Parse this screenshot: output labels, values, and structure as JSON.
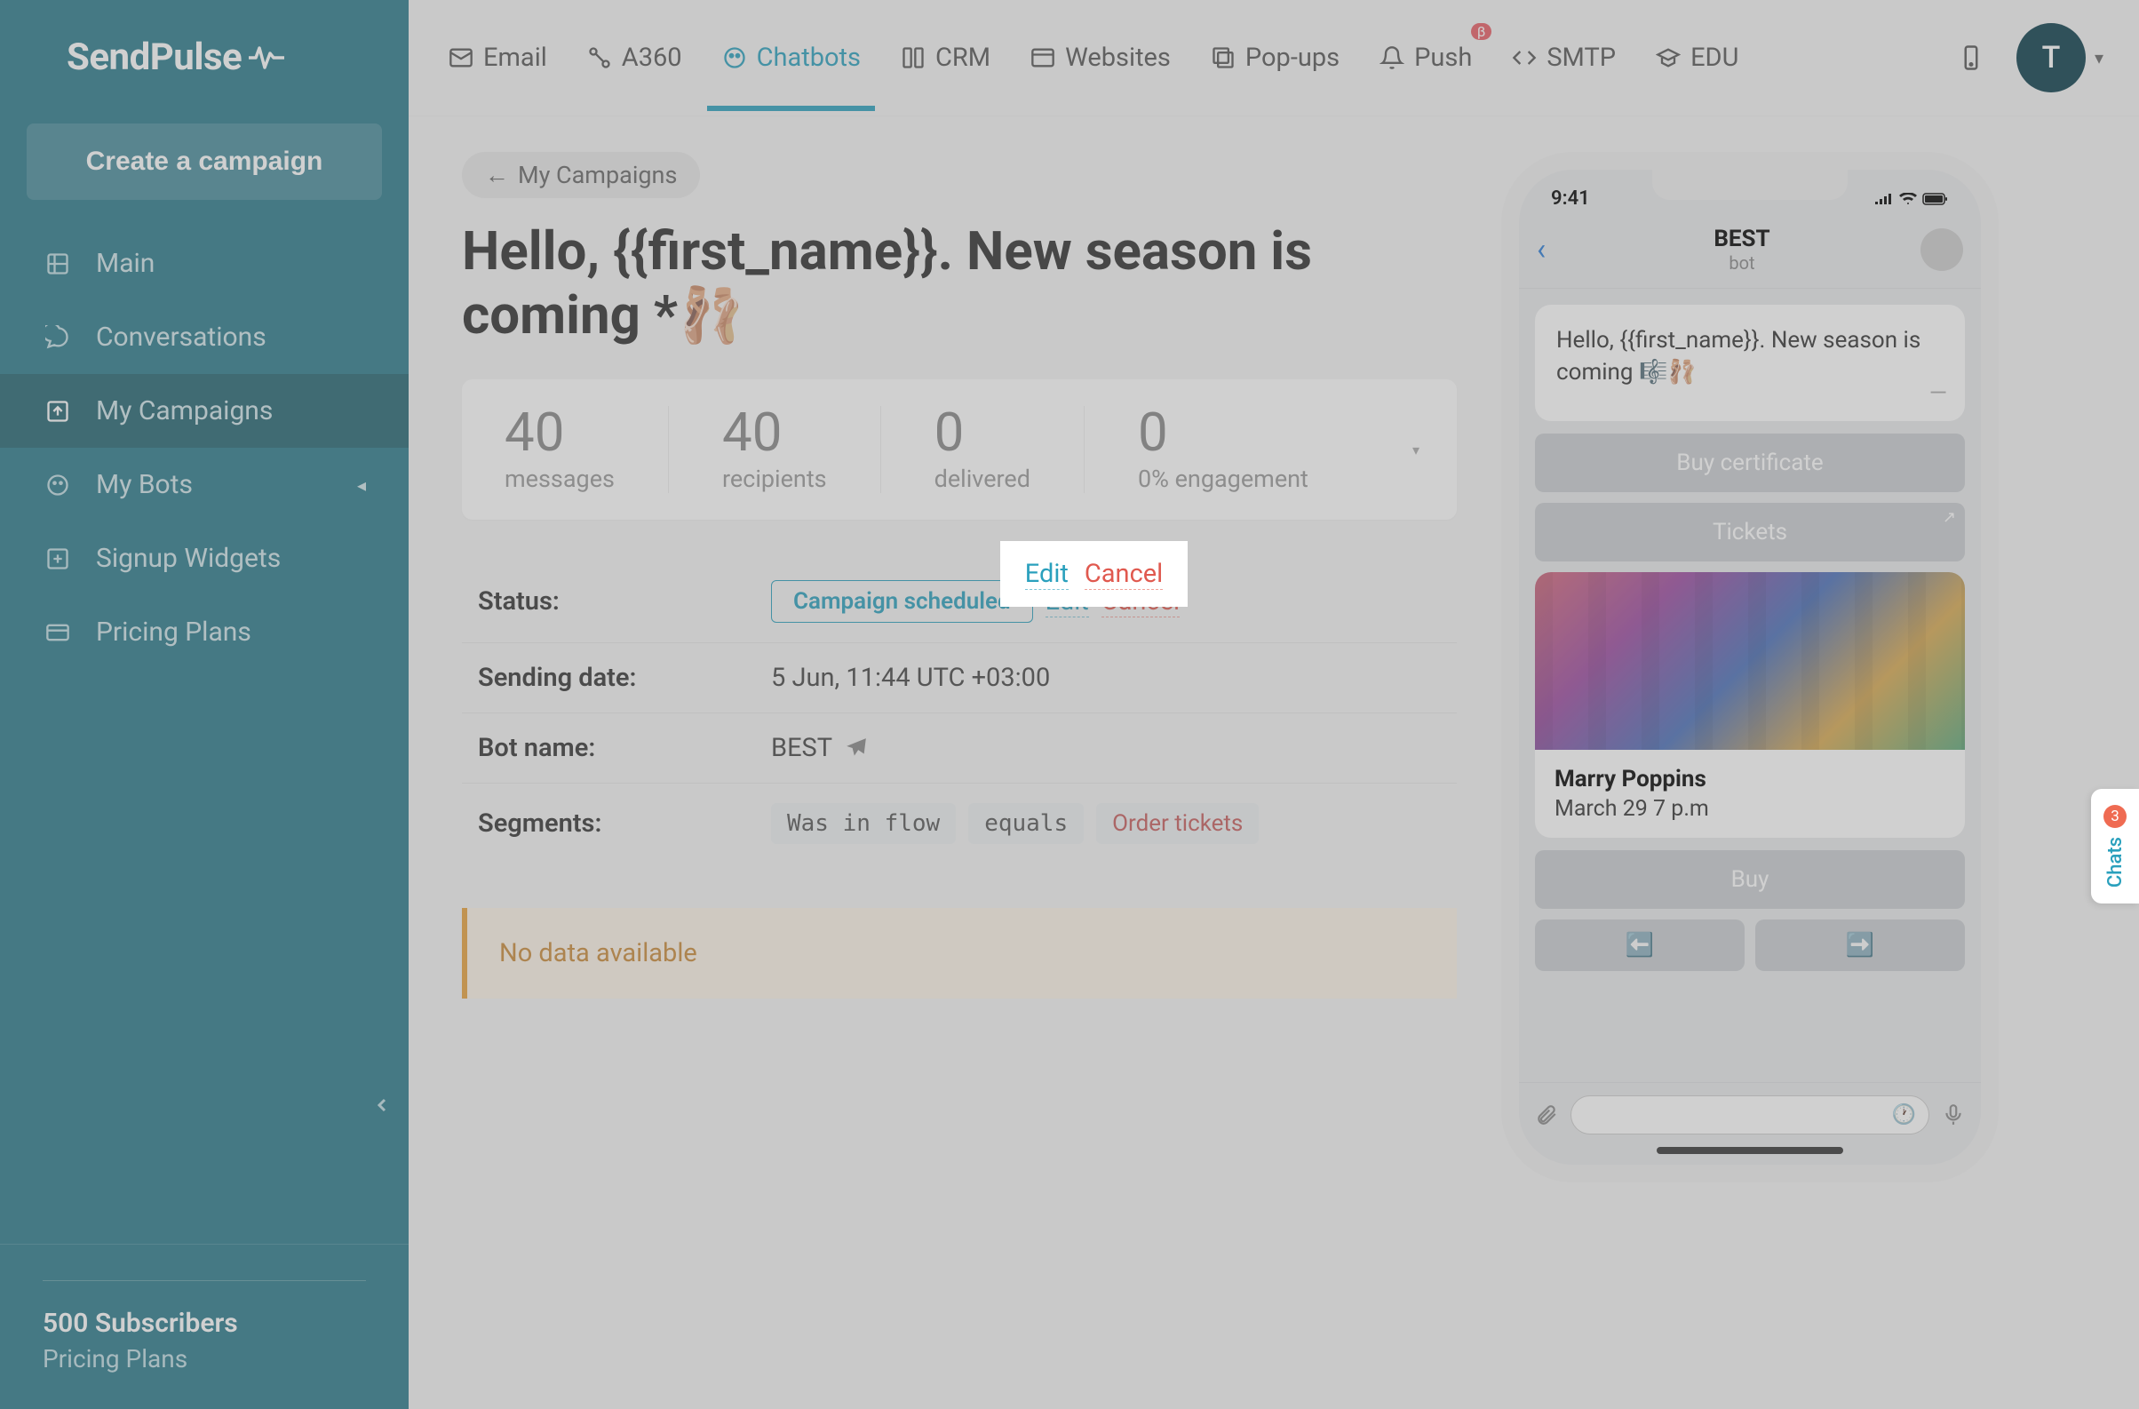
{
  "brand": "SendPulse",
  "sidebar": {
    "create_label": "Create a campaign",
    "items": [
      {
        "label": "Main"
      },
      {
        "label": "Conversations"
      },
      {
        "label": "My Campaigns"
      },
      {
        "label": "My Bots"
      },
      {
        "label": "Signup Widgets"
      },
      {
        "label": "Pricing Plans"
      }
    ],
    "subscribers": "500 Subscribers",
    "plan": "Pricing Plans"
  },
  "topnav": [
    {
      "label": "Email"
    },
    {
      "label": "A360"
    },
    {
      "label": "Chatbots"
    },
    {
      "label": "CRM"
    },
    {
      "label": "Websites"
    },
    {
      "label": "Pop-ups"
    },
    {
      "label": "Push",
      "badge": "β"
    },
    {
      "label": "SMTP"
    },
    {
      "label": "EDU"
    }
  ],
  "avatar_letter": "T",
  "breadcrumb": "My Campaigns",
  "page_title": "Hello, {{first_name}}. New season is coming *🩰",
  "stats": [
    {
      "value": "40",
      "label": "messages"
    },
    {
      "value": "40",
      "label": "recipients"
    },
    {
      "value": "0",
      "label": "delivered"
    },
    {
      "value": "0",
      "label": "0% engagement"
    }
  ],
  "details": {
    "status_label": "Status:",
    "status_badge": "Campaign scheduled",
    "edit": "Edit",
    "cancel": "Cancel",
    "sending_date_label": "Sending date:",
    "sending_date_value": "5 Jun, 11:44 UTC +03:00",
    "bot_name_label": "Bot name:",
    "bot_name_value": "BEST",
    "segments_label": "Segments:",
    "seg_field": "Was in flow",
    "seg_op": "equals",
    "seg_val": "Order tickets"
  },
  "no_data": "No data available",
  "phone": {
    "time": "9:41",
    "bot_name": "BEST",
    "bot_sub": "bot",
    "msg_text": "Hello, {{first_name}}. New season is coming 🎼🩰",
    "btn_cert": "Buy certificate",
    "btn_tickets": "Tickets",
    "card_title": "Marry Poppins",
    "card_sub": "March 29 7 p.m",
    "btn_buy": "Buy",
    "arrow_left": "⬅️",
    "arrow_right": "➡️"
  },
  "chats_tab": {
    "count": "3",
    "label": "Chats"
  }
}
